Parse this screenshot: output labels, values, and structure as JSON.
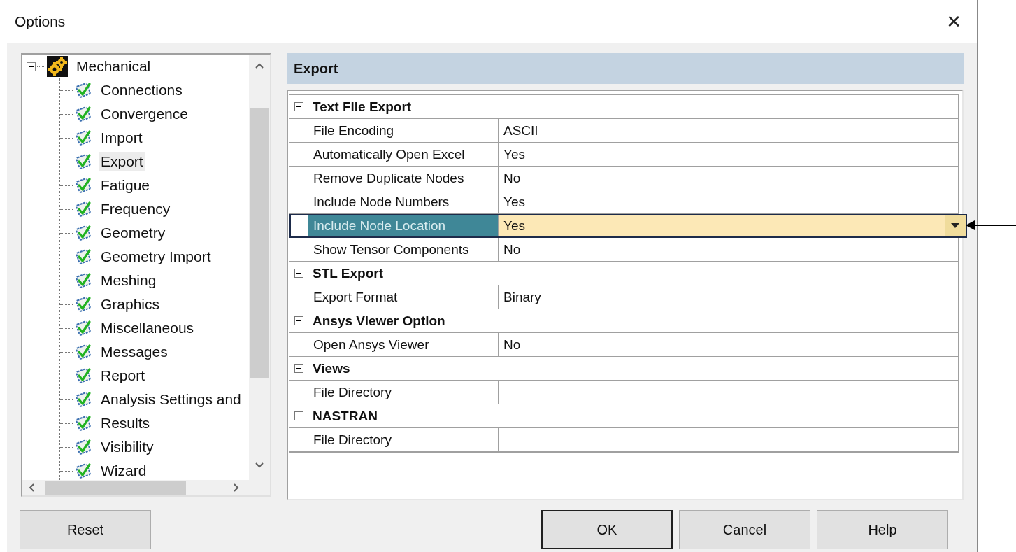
{
  "window": {
    "title": "Options",
    "close": "✕"
  },
  "tree": {
    "label": "Mechanical",
    "expanded": true,
    "children": [
      {
        "label": "Connections",
        "selected": false
      },
      {
        "label": "Convergence",
        "selected": false
      },
      {
        "label": "Import",
        "selected": false
      },
      {
        "label": "Export",
        "selected": true
      },
      {
        "label": "Fatigue",
        "selected": false
      },
      {
        "label": "Frequency",
        "selected": false
      },
      {
        "label": "Geometry",
        "selected": false
      },
      {
        "label": "Geometry Import",
        "selected": false
      },
      {
        "label": "Meshing",
        "selected": false
      },
      {
        "label": "Graphics",
        "selected": false
      },
      {
        "label": "Miscellaneous",
        "selected": false
      },
      {
        "label": "Messages",
        "selected": false
      },
      {
        "label": "Report",
        "selected": false
      },
      {
        "label": "Analysis Settings and",
        "selected": false
      },
      {
        "label": "Results",
        "selected": false
      },
      {
        "label": "Visibility",
        "selected": false
      },
      {
        "label": "Wizard",
        "selected": false
      }
    ]
  },
  "panel": {
    "title": "Export",
    "categories": [
      {
        "label": "Text File Export",
        "expanded": true,
        "rows": [
          {
            "name": "File Encoding",
            "value": "ASCII",
            "selected": false
          },
          {
            "name": "Automatically Open Excel",
            "value": "Yes",
            "selected": false
          },
          {
            "name": "Remove Duplicate Nodes",
            "value": "No",
            "selected": false
          },
          {
            "name": "Include Node Numbers",
            "value": "Yes",
            "selected": false
          },
          {
            "name": "Include Node Location",
            "value": "Yes",
            "selected": true
          },
          {
            "name": "Show Tensor Components",
            "value": "No",
            "selected": false
          }
        ]
      },
      {
        "label": "STL Export",
        "expanded": true,
        "rows": [
          {
            "name": "Export Format",
            "value": "Binary",
            "selected": false
          }
        ]
      },
      {
        "label": "Ansys Viewer Option",
        "expanded": true,
        "rows": [
          {
            "name": "Open Ansys Viewer",
            "value": "No",
            "selected": false
          }
        ]
      },
      {
        "label": "Views",
        "expanded": true,
        "rows": [
          {
            "name": "File Directory",
            "value": "",
            "selected": false
          }
        ]
      },
      {
        "label": "NASTRAN",
        "expanded": true,
        "rows": [
          {
            "name": "File Directory",
            "value": "",
            "selected": false
          }
        ]
      }
    ]
  },
  "buttons": [
    {
      "label": "Reset",
      "default": false
    },
    {
      "label": "OK",
      "default": true
    },
    {
      "label": "Cancel",
      "default": false
    },
    {
      "label": "Help",
      "default": false
    }
  ]
}
